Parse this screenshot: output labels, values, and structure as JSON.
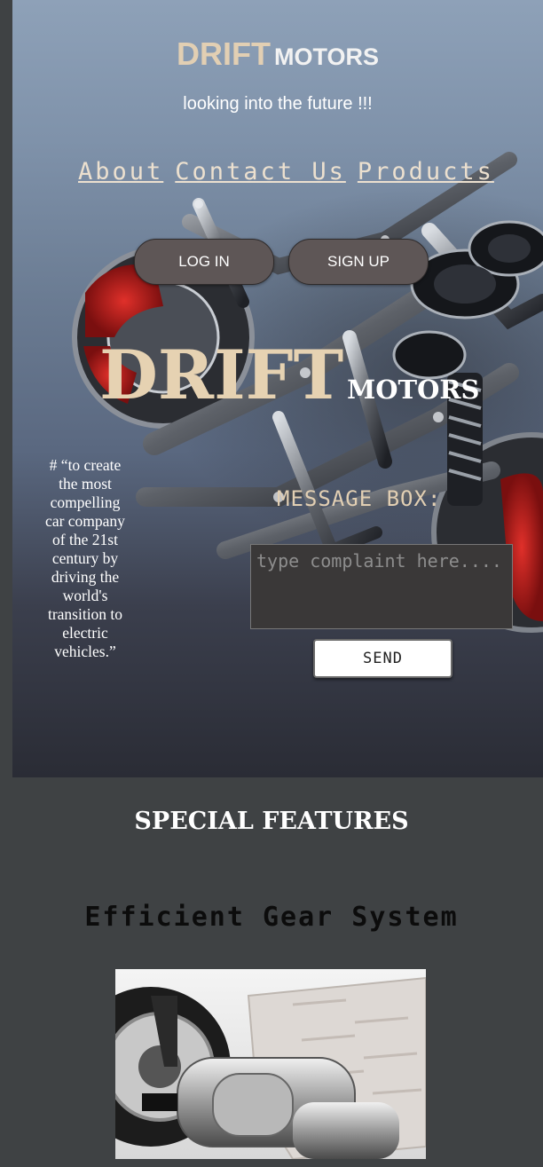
{
  "brand": {
    "primary": "DRIFT",
    "secondary": "MOTORS"
  },
  "tagline": "looking into the future !!!",
  "nav": {
    "items": [
      "About",
      "Contact Us",
      "Products"
    ]
  },
  "auth": {
    "login_label": "LOG IN",
    "signup_label": "SIGN UP"
  },
  "hero_brand": {
    "primary": "DRIFT",
    "secondary": "MOTORS"
  },
  "quote": "# “to create the most compelling car company of the 21st century by driving the world's transition to electric vehicles.”",
  "message": {
    "label": "MESSAGE BOX:",
    "placeholder": "type complaint here....",
    "send_label": "SEND"
  },
  "features": {
    "title": "SPECIAL FEATURES",
    "items": [
      {
        "title": "Efficient Gear System"
      }
    ]
  },
  "colors": {
    "accent": "#e2cfb3",
    "page_background": "#3f4244",
    "button": "#5e5656",
    "hero_top": "#8ea1b8",
    "hero_bottom": "#2a2c35"
  },
  "icons": {
    "hero_image": "car-chassis-image",
    "feature_image": "ev-drivetrain-image"
  }
}
